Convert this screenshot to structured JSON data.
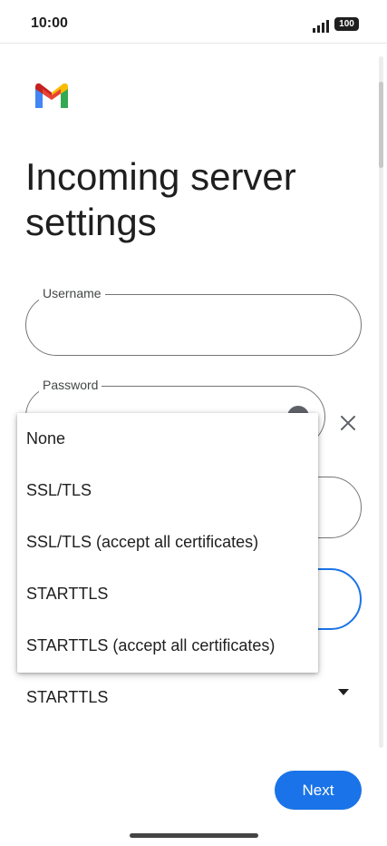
{
  "status_bar": {
    "time": "10:00",
    "battery": "100",
    "icons": [
      "signal-icon",
      "battery-icon"
    ]
  },
  "logo": {
    "icon": "gmail-logo",
    "colors": [
      "#4285F4",
      "#EA4335",
      "#FBBC04",
      "#34A853",
      "#C5221F"
    ]
  },
  "page": {
    "title": "Incoming server settings"
  },
  "form": {
    "username": {
      "label": "Username",
      "value": ""
    },
    "password": {
      "label": "Password",
      "value": "",
      "icons": [
        "visibility-icon",
        "clear-icon"
      ]
    },
    "security_type": {
      "value": "STARTTLS",
      "icon": "dropdown-arrow-icon"
    }
  },
  "dropdown": {
    "options": [
      "None",
      "SSL/TLS",
      "SSL/TLS (accept all certificates)",
      "STARTTLS",
      "STARTTLS (accept all certificates)"
    ]
  },
  "footer": {
    "next_label": "Next"
  },
  "colors": {
    "accent": "#1a73e8",
    "text": "#1f1f1f",
    "outline": "#757575"
  }
}
